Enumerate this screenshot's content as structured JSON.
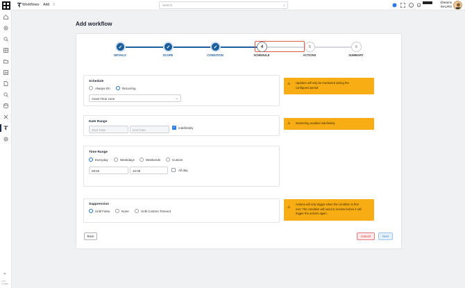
{
  "header": {
    "breadcrumb_root": "Workflows",
    "breadcrumb_sep": "›",
    "breadcrumb_current": "Add",
    "search_placeholder": "Search",
    "user_name": "@teams",
    "user_org": "INAURO"
  },
  "sidebar": {
    "version_line1": "v.0.1",
    "version_line2": "© 2024"
  },
  "page": {
    "title": "Add workflow"
  },
  "stepper": {
    "steps": [
      {
        "label": "DETAILS",
        "state": "done"
      },
      {
        "label": "SCOPE",
        "state": "done"
      },
      {
        "label": "CONDITION",
        "state": "done"
      },
      {
        "label": "SCHEDULE",
        "number": "4",
        "state": "current"
      },
      {
        "label": "ACTIONS",
        "number": "5",
        "state": "future"
      },
      {
        "label": "SUMMARY",
        "number": "6",
        "state": "future"
      }
    ]
  },
  "schedule": {
    "title": "Schedule",
    "option_always": "Always-On",
    "option_recurring": "Recurring",
    "selected": "Recurring",
    "timezone_value": "Asset Time zone"
  },
  "date_range": {
    "title": "Date Range",
    "start_placeholder": "Start Date",
    "end_placeholder": "End Date",
    "indefinitely_label": "Indefinitely",
    "indefinitely_checked": true
  },
  "time_range": {
    "title": "Time Range",
    "options": [
      "Everyday",
      "Weekdays",
      "Weekends",
      "Custom"
    ],
    "selected": "Everyday",
    "start_time": "09:50",
    "end_time": "10:09",
    "all_day_label": "All day",
    "all_day_checked": false
  },
  "suppression": {
    "title": "Suppression",
    "options": [
      "Until False",
      "None",
      "Until Custom Timeout"
    ],
    "selected": "Until False"
  },
  "warnings": {
    "schedule": [
      "Updates will only be monitored during the",
      "configured period"
    ],
    "date_range": [
      "Monitoring enabled indefinitely"
    ],
    "suppression": [
      "Actions will only trigger when the condition is first",
      "met. The condition will need to resolve before it will",
      "trigger the actions again."
    ]
  },
  "buttons": {
    "back": "Back",
    "cancel": "Cancel",
    "next": "Next"
  },
  "colors": {
    "primary": "#1b5e9e",
    "warning": "#f7ad13",
    "highlight": "#e05c4a"
  }
}
